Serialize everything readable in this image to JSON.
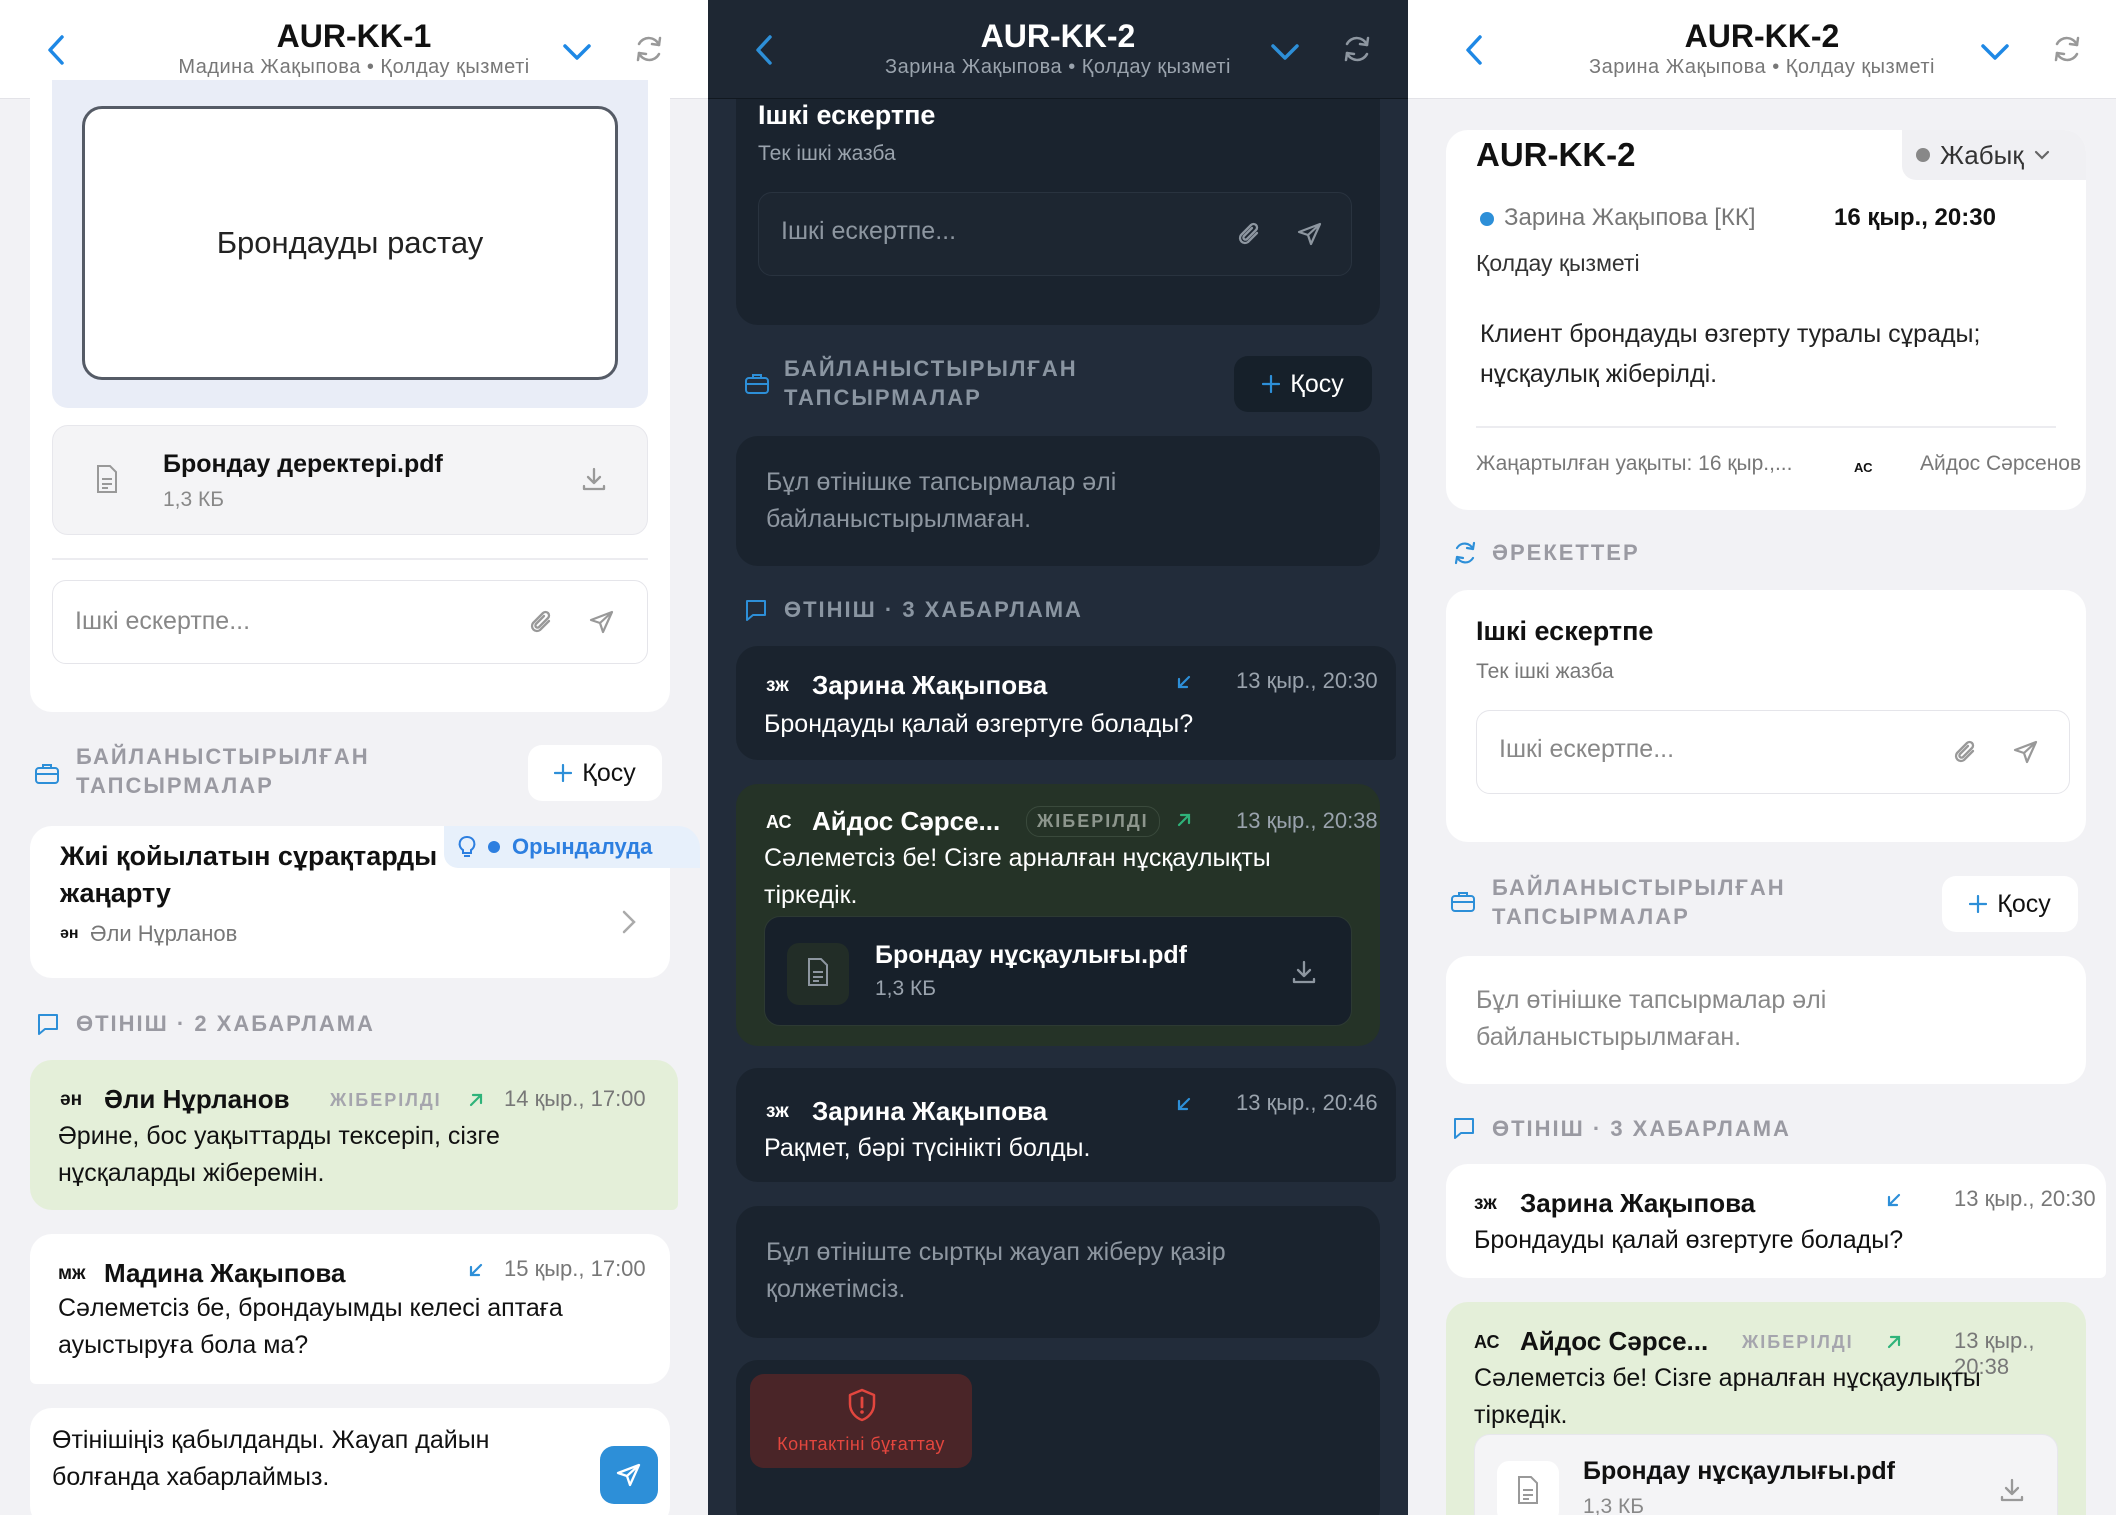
{
  "panel1": {
    "title": "AUR-KK-1",
    "subtitle": "Мадина Жақыпова • Қолдау қызметі",
    "action_button": "Брондауды растау",
    "attachment": {
      "name": "Брондау деректері.pdf",
      "size": "1,3 КБ"
    },
    "note_placeholder": "Ішкі ескертпе...",
    "linked_title": [
      "БАЙЛАНЫСТЫРЫЛҒАН",
      "ТАПСЫРМАЛАР"
    ],
    "add_label": "Қосу",
    "task": {
      "title": [
        "Жиі қойылатын сұрақтарды",
        "жаңарту"
      ],
      "status": "Орындалуда",
      "assignee_initials": "ән",
      "assignee": "Әли Нұрланов"
    },
    "thread_title": "ӨТІНІШ · 2 ХАБАРЛАМА",
    "messages": [
      {
        "initials": "ән",
        "author": "Әли Нұрланов",
        "badge": "ЖІБЕРІЛДІ",
        "time": "14 қыр., 17:00",
        "lines": [
          "Әрине, бос уақыттарды тексеріп, сізге",
          "нұсқаларды жіберемін."
        ]
      },
      {
        "initials": "мж",
        "author": "Мадина Жақыпова",
        "time": "15 қыр., 17:00",
        "lines": [
          "Сәлеметсіз бе, брондауымды келесі аптаға",
          "ауыстыруға бола ма?"
        ]
      }
    ],
    "composer": [
      "Өтінішіңіз қабылданды. Жауап дайын",
      "болғанда хабарлаймыз."
    ]
  },
  "panel2": {
    "title": "AUR-KK-2",
    "subtitle": "Зарина Жақыпова • Қолдау қызметі",
    "note_title": "Ішкі ескертпе",
    "note_sub": "Тек ішкі жазба",
    "note_placeholder": "Ішкі ескертпе...",
    "linked_title": [
      "БАЙЛАНЫСТЫРЫЛҒАН",
      "ТАПСЫРМАЛАР"
    ],
    "add_label": "Қосу",
    "no_tasks": [
      "Бұл өтінішке тапсырмалар әлі",
      "байланыстырылмаған."
    ],
    "thread_title": "ӨТІНІШ · 3 ХАБАРЛАМА",
    "messages": [
      {
        "initials": "зж",
        "author": "Зарина Жақыпова",
        "time": "13 қыр., 20:30",
        "lines": [
          "Брондауды қалай өзгертуге болады?"
        ]
      },
      {
        "initials": "АС",
        "author": "Айдос Сәрсе...",
        "badge": "ЖІБЕРІЛДІ",
        "time": "13 қыр., 20:38",
        "lines": [
          "Сәлеметсіз бе! Сізге арналған нұсқаулықты",
          "тіркедік."
        ],
        "attachment": {
          "name": "Брондау нұсқаулығы.pdf",
          "size": "1,3 КБ"
        }
      },
      {
        "initials": "зж",
        "author": "Зарина Жақыпова",
        "time": "13 қыр., 20:46",
        "lines": [
          "Рақмет, бәрі түсінікті болды."
        ]
      }
    ],
    "unavailable": [
      "Бұл өтініште сыртқы жауап жіберу қазір",
      "қолжетімсіз."
    ],
    "block_label": "Контактіні бұғаттау"
  },
  "panel3": {
    "title": "AUR-KK-2",
    "subtitle": "Зарина Жақыпова • Қолдау қызметі",
    "ticket_id": "AUR-KK-2",
    "status": "Жабық",
    "requester": "Зарина Жақыпова [КК]",
    "created": "16 қыр., 20:30",
    "department": "Қолдау қызметі",
    "summary": [
      "Клиент брондауды өзгерту туралы сұрады;",
      "нұсқаулық жіберілді."
    ],
    "updated": "Жаңартылған уақыты: 16 қыр.,...",
    "agent_initials": "АС",
    "agent": "Айдос Сәрсенов",
    "actions_title": "ӘРЕКЕТТЕР",
    "note_title": "Ішкі ескертпе",
    "note_sub": "Тек ішкі жазба",
    "note_placeholder": "Ішкі ескертпе...",
    "linked_title": [
      "БАЙЛАНЫСТЫРЫЛҒАН",
      "ТАПСЫРМАЛАР"
    ],
    "add_label": "Қосу",
    "no_tasks": [
      "Бұл өтінішке тапсырмалар әлі",
      "байланыстырылмаған."
    ],
    "thread_title": "ӨТІНІШ · 3 ХАБАРЛАМА",
    "messages": [
      {
        "initials": "зж",
        "author": "Зарина Жақыпова",
        "time": "13 қыр., 20:30",
        "lines": [
          "Брондауды қалай өзгертуге болады?"
        ]
      },
      {
        "initials": "АС",
        "author": "Айдос Сәрсе...",
        "badge": "ЖІБЕРІЛДІ",
        "time": "13 қыр., 20:38",
        "lines": [
          "Сәлеметсіз бе! Сізге арналған нұсқаулықты",
          "тіркедік."
        ],
        "attachment": {
          "name": "Брондау нұсқаулығы.pdf",
          "size": "1,3 КБ"
        }
      }
    ]
  },
  "colors": {
    "accent": "#2d8fd8",
    "progress": "#2d7fe0",
    "green_bubble": "#e4efd9",
    "dark_green_bubble": "#253327",
    "danger": "#e3463e",
    "incoming_arrow": "#2d8fd8",
    "outgoing_arrow": "#2fb37a"
  },
  "icons": [
    "back-chevron-icon",
    "chevron-down-icon",
    "refresh-icon",
    "document-icon",
    "download-icon",
    "attach-icon",
    "send-icon",
    "plus-icon",
    "briefcase-icon",
    "chat-icon",
    "bulb-icon",
    "chevron-right-icon",
    "arrow-in-icon",
    "arrow-out-icon",
    "shield-alert-icon",
    "actions-icon"
  ]
}
